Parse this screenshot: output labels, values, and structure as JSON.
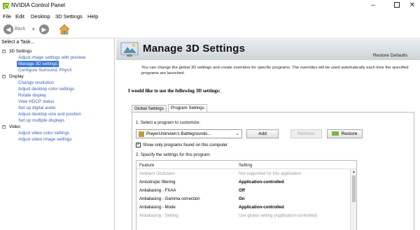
{
  "window": {
    "title": "NVIDIA Control Panel",
    "minimize_glyph": "–",
    "close_glyph": "✕"
  },
  "menu": [
    "File",
    "Edit",
    "Desktop",
    "3D Settings",
    "Help"
  ],
  "toolbar": {
    "back_label": "Back",
    "back_glyph": "◀",
    "dropdown_glyph": "▾",
    "forward_glyph": "▶"
  },
  "sidebar": {
    "header": "Select a Task...",
    "categories": [
      {
        "toggle": "−",
        "label": "3D Settings",
        "items": [
          "Adjust image settings with preview",
          "Manage 3D settings",
          "Configure Surround, PhysX"
        ]
      },
      {
        "toggle": "−",
        "label": "Display",
        "items": [
          "Change resolution",
          "Adjust desktop color settings",
          "Rotate display",
          "View HDCP status",
          "Set up digital audio",
          "Adjust desktop size and position",
          "Set up multiple displays"
        ]
      },
      {
        "toggle": "−",
        "label": "Video",
        "items": [
          "Adjust video color settings",
          "Adjust video image settings"
        ]
      }
    ],
    "selected_item": "Manage 3D settings"
  },
  "main": {
    "title": "Manage 3D Settings",
    "restore_defaults": "Restore Defaults",
    "description": "You can change the global 3D settings and create overrides for specific programs. The overrides will be used automatically each time the specified programs are launched.",
    "section_heading": "I would like to use the following 3D settings:",
    "tabs": [
      {
        "label": "Global Settings",
        "active": false
      },
      {
        "label": "Program Settings",
        "active": true
      }
    ],
    "step1": "1. Select a program to customize:",
    "program": "PlayerUnknown's Battlegrounds...",
    "dropdown_glyph": "⌄",
    "buttons": {
      "add": "Add",
      "remove": "Remove",
      "restore": "Restore"
    },
    "checkbox_glyph": "✓",
    "checkbox_label": "Show only programs found on this computer",
    "step2": "2. Specify the settings for this program:",
    "grid": {
      "col_feature": "Feature",
      "col_setting": "Setting",
      "scroll_up_glyph": "▲",
      "rows": [
        {
          "feature": "Ambient Occlusion",
          "setting": "Not supported for this application",
          "muted": true,
          "bold": false
        },
        {
          "feature": "Anisotropic filtering",
          "setting": "Application-controlled",
          "muted": false,
          "bold": true
        },
        {
          "feature": "Antialiasing - FXAA",
          "setting": "Off",
          "muted": false,
          "bold": true
        },
        {
          "feature": "Antialiasing - Gamma correction",
          "setting": "On",
          "muted": false,
          "bold": true
        },
        {
          "feature": "Antialiasing - Mode",
          "setting": "Application-controlled",
          "muted": false,
          "bold": true
        },
        {
          "feature": "Antialiasing - Setting",
          "setting": "Use global setting (Application-controlled)",
          "muted": true,
          "bold": false
        }
      ]
    }
  },
  "colors": {
    "nvidia_green": "#76b900",
    "link_blue": "#3a5fb0",
    "selected_bg": "#3a76d8"
  }
}
